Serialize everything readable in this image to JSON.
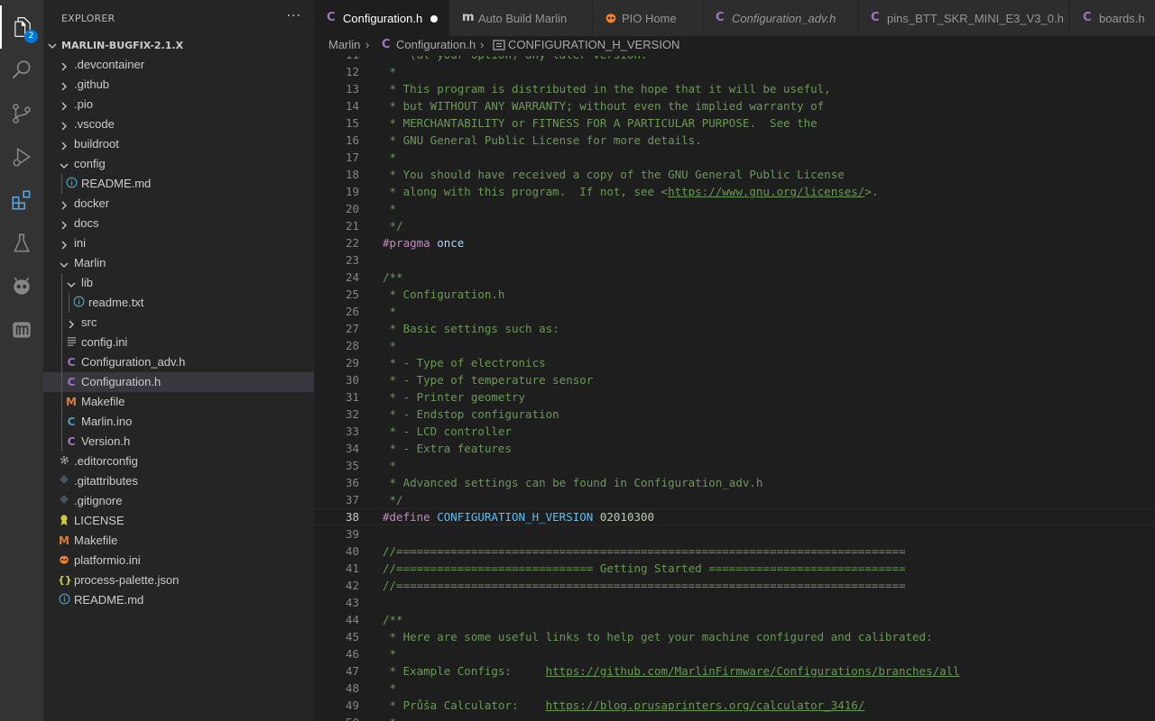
{
  "activity_bar": {
    "explorer_badge": "2"
  },
  "sidebar": {
    "title": "EXPLORER",
    "more": "···",
    "root_label": "MARLIN-BUGFIX-2.1.X",
    "tree": [
      {
        "label": ".devcontainer",
        "icon": "chevron-right"
      },
      {
        "label": ".github",
        "icon": "chevron-right"
      },
      {
        "label": ".pio",
        "icon": "chevron-right"
      },
      {
        "label": ".vscode",
        "icon": "chevron-right"
      },
      {
        "label": "buildroot",
        "icon": "chevron-right"
      },
      {
        "label": "config",
        "icon": "chevron-down"
      },
      {
        "label": "README.md",
        "icon": "info"
      },
      {
        "label": "docker",
        "icon": "chevron-right"
      },
      {
        "label": "docs",
        "icon": "chevron-right"
      },
      {
        "label": "ini",
        "icon": "chevron-right"
      },
      {
        "label": "Marlin",
        "icon": "chevron-down"
      },
      {
        "label": "lib",
        "icon": "chevron-down"
      },
      {
        "label": "readme.txt",
        "icon": "info"
      },
      {
        "label": "src",
        "icon": "chevron-right"
      },
      {
        "label": "config.ini",
        "icon": "lines"
      },
      {
        "label": "Configuration_adv.h",
        "icon": "c"
      },
      {
        "label": "Configuration.h",
        "icon": "c"
      },
      {
        "label": "Makefile",
        "icon": "m"
      },
      {
        "label": "Marlin.ino",
        "icon": "ino"
      },
      {
        "label": "Version.h",
        "icon": "c"
      },
      {
        "label": ".editorconfig",
        "icon": "gear"
      },
      {
        "label": ".gitattributes",
        "icon": "diamond"
      },
      {
        "label": ".gitignore",
        "icon": "diamond"
      },
      {
        "label": "LICENSE",
        "icon": "license"
      },
      {
        "label": "Makefile",
        "icon": "m"
      },
      {
        "label": "platformio.ini",
        "icon": "alien"
      },
      {
        "label": "process-palette.json",
        "icon": "braces"
      },
      {
        "label": "README.md",
        "icon": "info"
      }
    ]
  },
  "tabs": [
    {
      "label": "Configuration.h",
      "icon": "C",
      "color": "#a074c4"
    },
    {
      "label": "Auto Build Marlin",
      "icon": "m",
      "color": "#cccccc"
    },
    {
      "label": "PIO Home",
      "icon": "alien",
      "color": "#f5822a"
    },
    {
      "label": "Configuration_adv.h",
      "icon": "C",
      "color": "#a074c4"
    },
    {
      "label": "pins_BTT_SKR_MINI_E3_V3_0.h",
      "icon": "C",
      "color": "#a074c4"
    },
    {
      "label": "boards.h",
      "icon": "C",
      "color": "#a074c4"
    }
  ],
  "breadcrumb": {
    "folder": "Marlin",
    "sep1": "›",
    "file": "Configuration.h",
    "sep2": "›",
    "symbol": "CONFIGURATION_H_VERSION"
  },
  "editor": {
    "current_line": 38,
    "lines": [
      {
        "n": "11",
        "parts": [
          [
            "cm",
            " *  (at your option) any later version."
          ]
        ]
      },
      {
        "n": "12",
        "parts": [
          [
            "cm",
            " *"
          ]
        ]
      },
      {
        "n": "13",
        "parts": [
          [
            "cm",
            " * This program is distributed in the hope that it will be useful,"
          ]
        ]
      },
      {
        "n": "14",
        "parts": [
          [
            "cm",
            " * but WITHOUT ANY WARRANTY; without even the implied warranty of"
          ]
        ]
      },
      {
        "n": "15",
        "parts": [
          [
            "cm",
            " * MERCHANTABILITY or FITNESS FOR A PARTICULAR PURPOSE.  See the"
          ]
        ]
      },
      {
        "n": "16",
        "parts": [
          [
            "cm",
            " * GNU General Public License for more details."
          ]
        ]
      },
      {
        "n": "17",
        "parts": [
          [
            "cm",
            " *"
          ]
        ]
      },
      {
        "n": "18",
        "parts": [
          [
            "cm",
            " * You should have received a copy of the GNU General Public License"
          ]
        ]
      },
      {
        "n": "19",
        "parts": [
          [
            "cm",
            " * along with this program.  If not, see <"
          ],
          [
            "lnk",
            "https://www.gnu.org/licenses/"
          ],
          [
            "cm",
            ">."
          ]
        ]
      },
      {
        "n": "20",
        "parts": [
          [
            "cm",
            " *"
          ]
        ]
      },
      {
        "n": "21",
        "parts": [
          [
            "cm",
            " */"
          ]
        ]
      },
      {
        "n": "22",
        "parts": [
          [
            "kw",
            "#pragma"
          ],
          [
            "",
            " "
          ],
          [
            "id",
            "once"
          ]
        ]
      },
      {
        "n": "23",
        "parts": []
      },
      {
        "n": "24",
        "parts": [
          [
            "cm",
            "/**"
          ]
        ]
      },
      {
        "n": "25",
        "parts": [
          [
            "cm",
            " * Configuration.h"
          ]
        ]
      },
      {
        "n": "26",
        "parts": [
          [
            "cm",
            " *"
          ]
        ]
      },
      {
        "n": "27",
        "parts": [
          [
            "cm",
            " * Basic settings such as:"
          ]
        ]
      },
      {
        "n": "28",
        "parts": [
          [
            "cm",
            " *"
          ]
        ]
      },
      {
        "n": "29",
        "parts": [
          [
            "cm",
            " * - Type of electronics"
          ]
        ]
      },
      {
        "n": "30",
        "parts": [
          [
            "cm",
            " * - Type of temperature sensor"
          ]
        ]
      },
      {
        "n": "31",
        "parts": [
          [
            "cm",
            " * - Printer geometry"
          ]
        ]
      },
      {
        "n": "32",
        "parts": [
          [
            "cm",
            " * - Endstop configuration"
          ]
        ]
      },
      {
        "n": "33",
        "parts": [
          [
            "cm",
            " * - LCD controller"
          ]
        ]
      },
      {
        "n": "34",
        "parts": [
          [
            "cm",
            " * - Extra features"
          ]
        ]
      },
      {
        "n": "35",
        "parts": [
          [
            "cm",
            " *"
          ]
        ]
      },
      {
        "n": "36",
        "parts": [
          [
            "cm",
            " * Advanced settings can be found in Configuration_adv.h"
          ]
        ]
      },
      {
        "n": "37",
        "parts": [
          [
            "cm",
            " */"
          ]
        ]
      },
      {
        "n": "38",
        "parts": [
          [
            "kw",
            "#define"
          ],
          [
            "",
            " "
          ],
          [
            "mac",
            "CONFIGURATION_H_VERSION"
          ],
          [
            "",
            " "
          ],
          [
            "num",
            "02010300"
          ]
        ]
      },
      {
        "n": "39",
        "parts": []
      },
      {
        "n": "40",
        "parts": [
          [
            "cm",
            "//==========================================================================="
          ]
        ]
      },
      {
        "n": "41",
        "parts": [
          [
            "cm",
            "//============================= Getting Started ============================="
          ]
        ]
      },
      {
        "n": "42",
        "parts": [
          [
            "cm",
            "//==========================================================================="
          ]
        ]
      },
      {
        "n": "43",
        "parts": []
      },
      {
        "n": "44",
        "parts": [
          [
            "cm",
            "/**"
          ]
        ]
      },
      {
        "n": "45",
        "parts": [
          [
            "cm",
            " * Here are some useful links to help get your machine configured and calibrated:"
          ]
        ]
      },
      {
        "n": "46",
        "parts": [
          [
            "cm",
            " *"
          ]
        ]
      },
      {
        "n": "47",
        "parts": [
          [
            "cm",
            " * Example Configs:     "
          ],
          [
            "lnk",
            "https://github.com/MarlinFirmware/Configurations/branches/all"
          ]
        ]
      },
      {
        "n": "48",
        "parts": [
          [
            "cm",
            " *"
          ]
        ]
      },
      {
        "n": "49",
        "parts": [
          [
            "cm",
            " * Průša Calculator:    "
          ],
          [
            "lnk",
            "https://blog.prusaprinters.org/calculator_3416/"
          ]
        ]
      },
      {
        "n": "50",
        "parts": [
          [
            "cm",
            " *"
          ]
        ]
      }
    ]
  },
  "colors": {
    "accent": "#0078d4",
    "c_icon": "#a074c4",
    "m_icon": "#e37933",
    "info_icon": "#519aba",
    "comment": "#6a9955"
  }
}
